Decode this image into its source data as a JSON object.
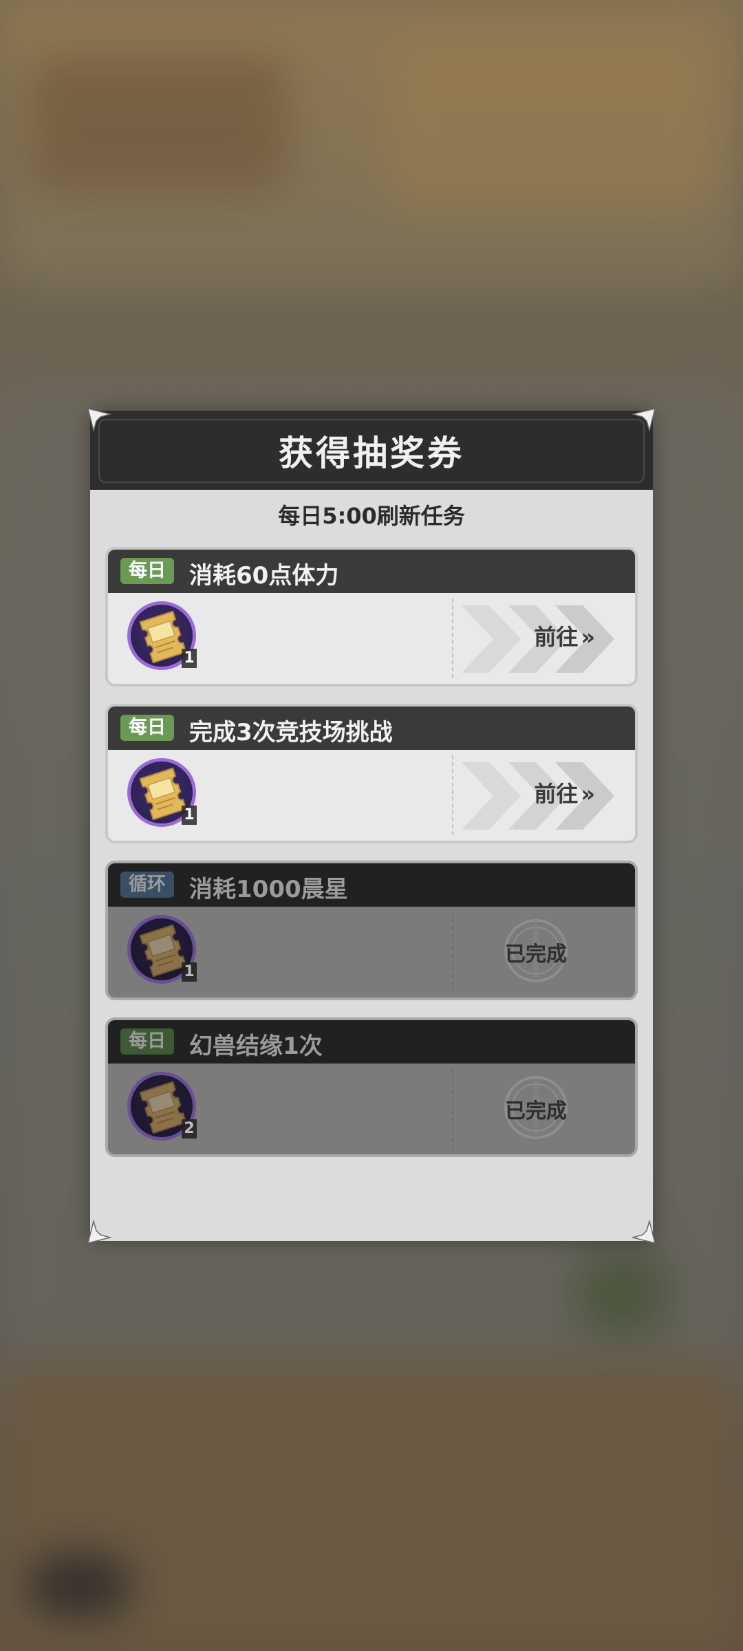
{
  "dialog": {
    "title": "获得抽奖券",
    "subtitle": "每日5:00刷新任务"
  },
  "tasks": [
    {
      "badge": "每日",
      "badge_type": "daily",
      "title": "消耗60点体力",
      "reward_qty": "1",
      "action": "前往",
      "action_icon": "double-chevron-right-icon",
      "state": "available"
    },
    {
      "badge": "每日",
      "badge_type": "daily",
      "title": "完成3次竞技场挑战",
      "reward_qty": "1",
      "action": "前往",
      "action_icon": "double-chevron-right-icon",
      "state": "available"
    },
    {
      "badge": "循环",
      "badge_type": "cycle",
      "title": "消耗1000晨星",
      "reward_qty": "1",
      "action": "已完成",
      "action_icon": "completed-stamp-icon",
      "state": "completed"
    },
    {
      "badge": "每日",
      "badge_type": "daily",
      "title": "幻兽结缘1次",
      "reward_qty": "2",
      "action": "已完成",
      "action_icon": "completed-stamp-icon",
      "state": "completed"
    }
  ],
  "colors": {
    "badge_daily": "#6a9a54",
    "badge_cycle": "#4f6f90",
    "reward_ring": "#9a6ad6",
    "header_bg": "#2d2d2d"
  },
  "icons": {
    "reward": "lottery-ticket-icon",
    "corner": "corner-ornament-icon"
  }
}
